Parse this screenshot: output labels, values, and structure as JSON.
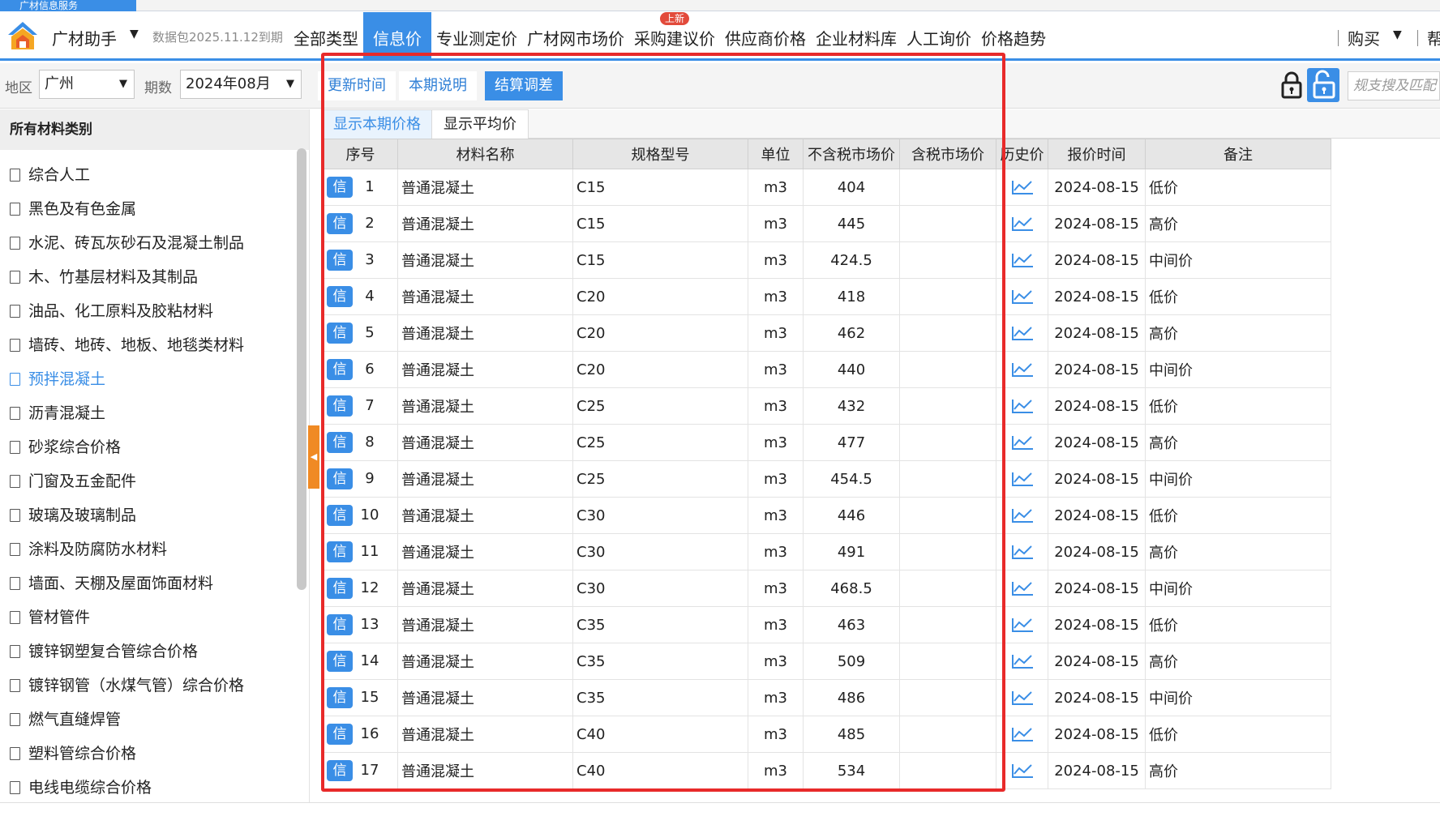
{
  "top_strip": {
    "tab_label": "广材信息服务"
  },
  "header": {
    "brand": "广材助手",
    "expire_note": "数据包2025.11.12到期",
    "nav": [
      {
        "label": "全部类型",
        "active": false
      },
      {
        "label": "信息价",
        "active": true
      },
      {
        "label": "专业测定价",
        "active": false
      },
      {
        "label": "广材网市场价",
        "active": false
      },
      {
        "label": "采购建议价",
        "active": false,
        "badge": "上新"
      },
      {
        "label": "供应商价格",
        "active": false
      },
      {
        "label": "企业材料库",
        "active": false
      },
      {
        "label": "人工询价",
        "active": false
      },
      {
        "label": "价格趋势",
        "active": false
      }
    ],
    "buy_label": "购买",
    "help_label": "帮"
  },
  "filter": {
    "region_label": "地区",
    "region_value": "广州",
    "period_label": "期数",
    "period_value": "2024年08月",
    "btn_update": "更新时间",
    "btn_notes": "本期说明",
    "btn_settle": "结算调差",
    "search_placeholder": "规支搜及匹配"
  },
  "sidebar": {
    "header": "所有材料类别",
    "items": [
      {
        "label": "综合人工",
        "active": false
      },
      {
        "label": "黑色及有色金属",
        "active": false
      },
      {
        "label": "水泥、砖瓦灰砂石及混凝土制品",
        "active": false
      },
      {
        "label": "木、竹基层材料及其制品",
        "active": false
      },
      {
        "label": "油品、化工原料及胶粘材料",
        "active": false
      },
      {
        "label": "墙砖、地砖、地板、地毯类材料",
        "active": false
      },
      {
        "label": "预拌混凝土",
        "active": true
      },
      {
        "label": "沥青混凝土",
        "active": false
      },
      {
        "label": "砂浆综合价格",
        "active": false
      },
      {
        "label": "门窗及五金配件",
        "active": false
      },
      {
        "label": "玻璃及玻璃制品",
        "active": false
      },
      {
        "label": "涂料及防腐防水材料",
        "active": false
      },
      {
        "label": "墙面、天棚及屋面饰面材料",
        "active": false
      },
      {
        "label": "管材管件",
        "active": false
      },
      {
        "label": "镀锌钢塑复合管综合价格",
        "active": false
      },
      {
        "label": "镀锌钢管（水煤气管）综合价格",
        "active": false
      },
      {
        "label": "燃气直缝焊管",
        "active": false
      },
      {
        "label": "塑料管综合价格",
        "active": false
      },
      {
        "label": "电线电缆综合价格",
        "active": false
      }
    ]
  },
  "subtabs": {
    "current": "显示本期价格",
    "average": "显示平均价"
  },
  "table": {
    "columns": [
      "序号",
      "材料名称",
      "规格型号",
      "单位",
      "不含税市场价",
      "含税市场价",
      "历史价",
      "报价时间",
      "备注"
    ],
    "badge": "信",
    "rows": [
      {
        "no": "1",
        "name": "普通混凝土",
        "spec": "C15",
        "unit": "m3",
        "price": "404",
        "tax_price": "",
        "date": "2024-08-15",
        "note": "低价"
      },
      {
        "no": "2",
        "name": "普通混凝土",
        "spec": "C15",
        "unit": "m3",
        "price": "445",
        "tax_price": "",
        "date": "2024-08-15",
        "note": "高价"
      },
      {
        "no": "3",
        "name": "普通混凝土",
        "spec": "C15",
        "unit": "m3",
        "price": "424.5",
        "tax_price": "",
        "date": "2024-08-15",
        "note": "中间价"
      },
      {
        "no": "4",
        "name": "普通混凝土",
        "spec": "C20",
        "unit": "m3",
        "price": "418",
        "tax_price": "",
        "date": "2024-08-15",
        "note": "低价"
      },
      {
        "no": "5",
        "name": "普通混凝土",
        "spec": "C20",
        "unit": "m3",
        "price": "462",
        "tax_price": "",
        "date": "2024-08-15",
        "note": "高价"
      },
      {
        "no": "6",
        "name": "普通混凝土",
        "spec": "C20",
        "unit": "m3",
        "price": "440",
        "tax_price": "",
        "date": "2024-08-15",
        "note": "中间价"
      },
      {
        "no": "7",
        "name": "普通混凝土",
        "spec": "C25",
        "unit": "m3",
        "price": "432",
        "tax_price": "",
        "date": "2024-08-15",
        "note": "低价"
      },
      {
        "no": "8",
        "name": "普通混凝土",
        "spec": "C25",
        "unit": "m3",
        "price": "477",
        "tax_price": "",
        "date": "2024-08-15",
        "note": "高价"
      },
      {
        "no": "9",
        "name": "普通混凝土",
        "spec": "C25",
        "unit": "m3",
        "price": "454.5",
        "tax_price": "",
        "date": "2024-08-15",
        "note": "中间价"
      },
      {
        "no": "10",
        "name": "普通混凝土",
        "spec": "C30",
        "unit": "m3",
        "price": "446",
        "tax_price": "",
        "date": "2024-08-15",
        "note": "低价"
      },
      {
        "no": "11",
        "name": "普通混凝土",
        "spec": "C30",
        "unit": "m3",
        "price": "491",
        "tax_price": "",
        "date": "2024-08-15",
        "note": "高价"
      },
      {
        "no": "12",
        "name": "普通混凝土",
        "spec": "C30",
        "unit": "m3",
        "price": "468.5",
        "tax_price": "",
        "date": "2024-08-15",
        "note": "中间价"
      },
      {
        "no": "13",
        "name": "普通混凝土",
        "spec": "C35",
        "unit": "m3",
        "price": "463",
        "tax_price": "",
        "date": "2024-08-15",
        "note": "低价"
      },
      {
        "no": "14",
        "name": "普通混凝土",
        "spec": "C35",
        "unit": "m3",
        "price": "509",
        "tax_price": "",
        "date": "2024-08-15",
        "note": "高价"
      },
      {
        "no": "15",
        "name": "普通混凝土",
        "spec": "C35",
        "unit": "m3",
        "price": "486",
        "tax_price": "",
        "date": "2024-08-15",
        "note": "中间价"
      },
      {
        "no": "16",
        "name": "普通混凝土",
        "spec": "C40",
        "unit": "m3",
        "price": "485",
        "tax_price": "",
        "date": "2024-08-15",
        "note": "低价"
      },
      {
        "no": "17",
        "name": "普通混凝土",
        "spec": "C40",
        "unit": "m3",
        "price": "534",
        "tax_price": "",
        "date": "2024-08-15",
        "note": "高价"
      }
    ]
  },
  "colors": {
    "accent": "#3a8ee6",
    "highlight_border": "#e82a2a",
    "handle": "#f08a24"
  },
  "icons": {
    "logo": "app-logo-icon",
    "trend": "trend-chart-icon",
    "lock": "lock-icon",
    "unlock": "unlock-icon",
    "doc": "document-icon"
  }
}
